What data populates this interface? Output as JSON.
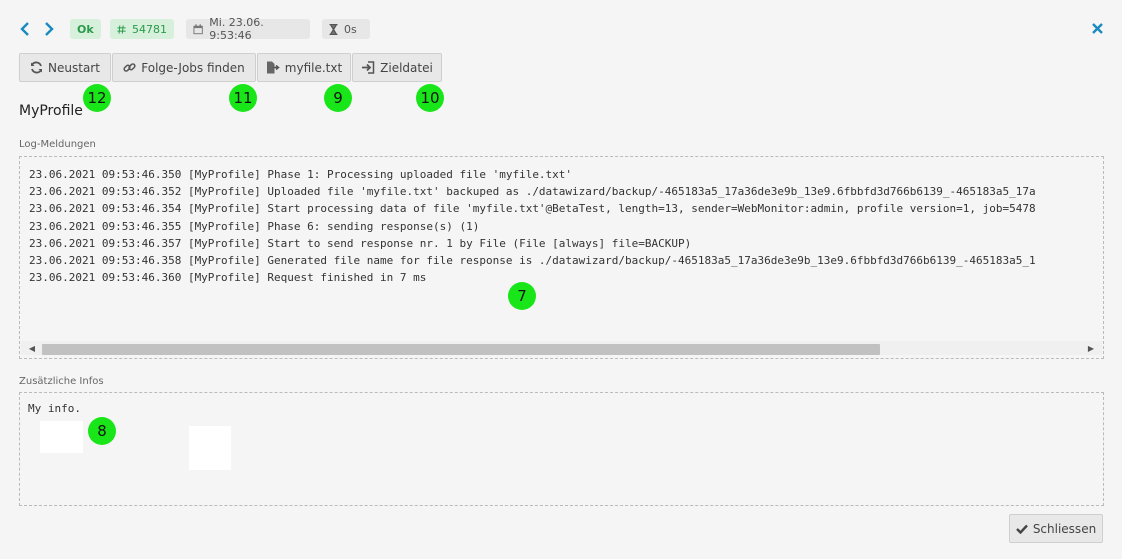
{
  "header": {
    "status": "Ok",
    "job_id": "54781",
    "datetime": "Mi. 23.06. 9:53:46",
    "duration": "0s"
  },
  "toolbar": {
    "restart_label": "Neustart",
    "followup_label": "Folge-Jobs finden",
    "input_file_label": "myfile.txt",
    "target_file_label": "Zieldatei"
  },
  "profile_name": "MyProfile",
  "log": {
    "label": "Log-Meldungen",
    "lines": [
      "23.06.2021 09:53:46.350 [MyProfile] Phase 1: Processing uploaded file 'myfile.txt'",
      "23.06.2021 09:53:46.352 [MyProfile] Uploaded file 'myfile.txt' backuped as ./datawizard/backup/-465183a5_17a36de3e9b_13e9.6fbbfd3d766b6139_-465183a5_17a",
      "23.06.2021 09:53:46.354 [MyProfile] Start processing data of file 'myfile.txt'@BetaTest, length=13, sender=WebMonitor:admin, profile version=1, job=5478",
      "23.06.2021 09:53:46.355 [MyProfile] Phase 6: sending response(s) (1)",
      "23.06.2021 09:53:46.357 [MyProfile] Start to send response nr. 1 by File (File [always] file=BACKUP)",
      "23.06.2021 09:53:46.358 [MyProfile] Generated file name for file response is ./datawizard/backup/-465183a5_17a36de3e9b_13e9.6fbbfd3d766b6139_-465183a5_1",
      "23.06.2021 09:53:46.360 [MyProfile] Request finished in 7 ms"
    ]
  },
  "info": {
    "label": "Zusätzliche Infos",
    "text": "My info."
  },
  "footer": {
    "close_label": "Schliessen"
  },
  "markers": [
    "12",
    "11",
    "9",
    "10",
    "7",
    "8"
  ],
  "colors": {
    "accent": "#1a8ac0",
    "ok_bg": "#d6f0dc",
    "ok_text": "#2a9a4a",
    "marker": "#19e619"
  }
}
